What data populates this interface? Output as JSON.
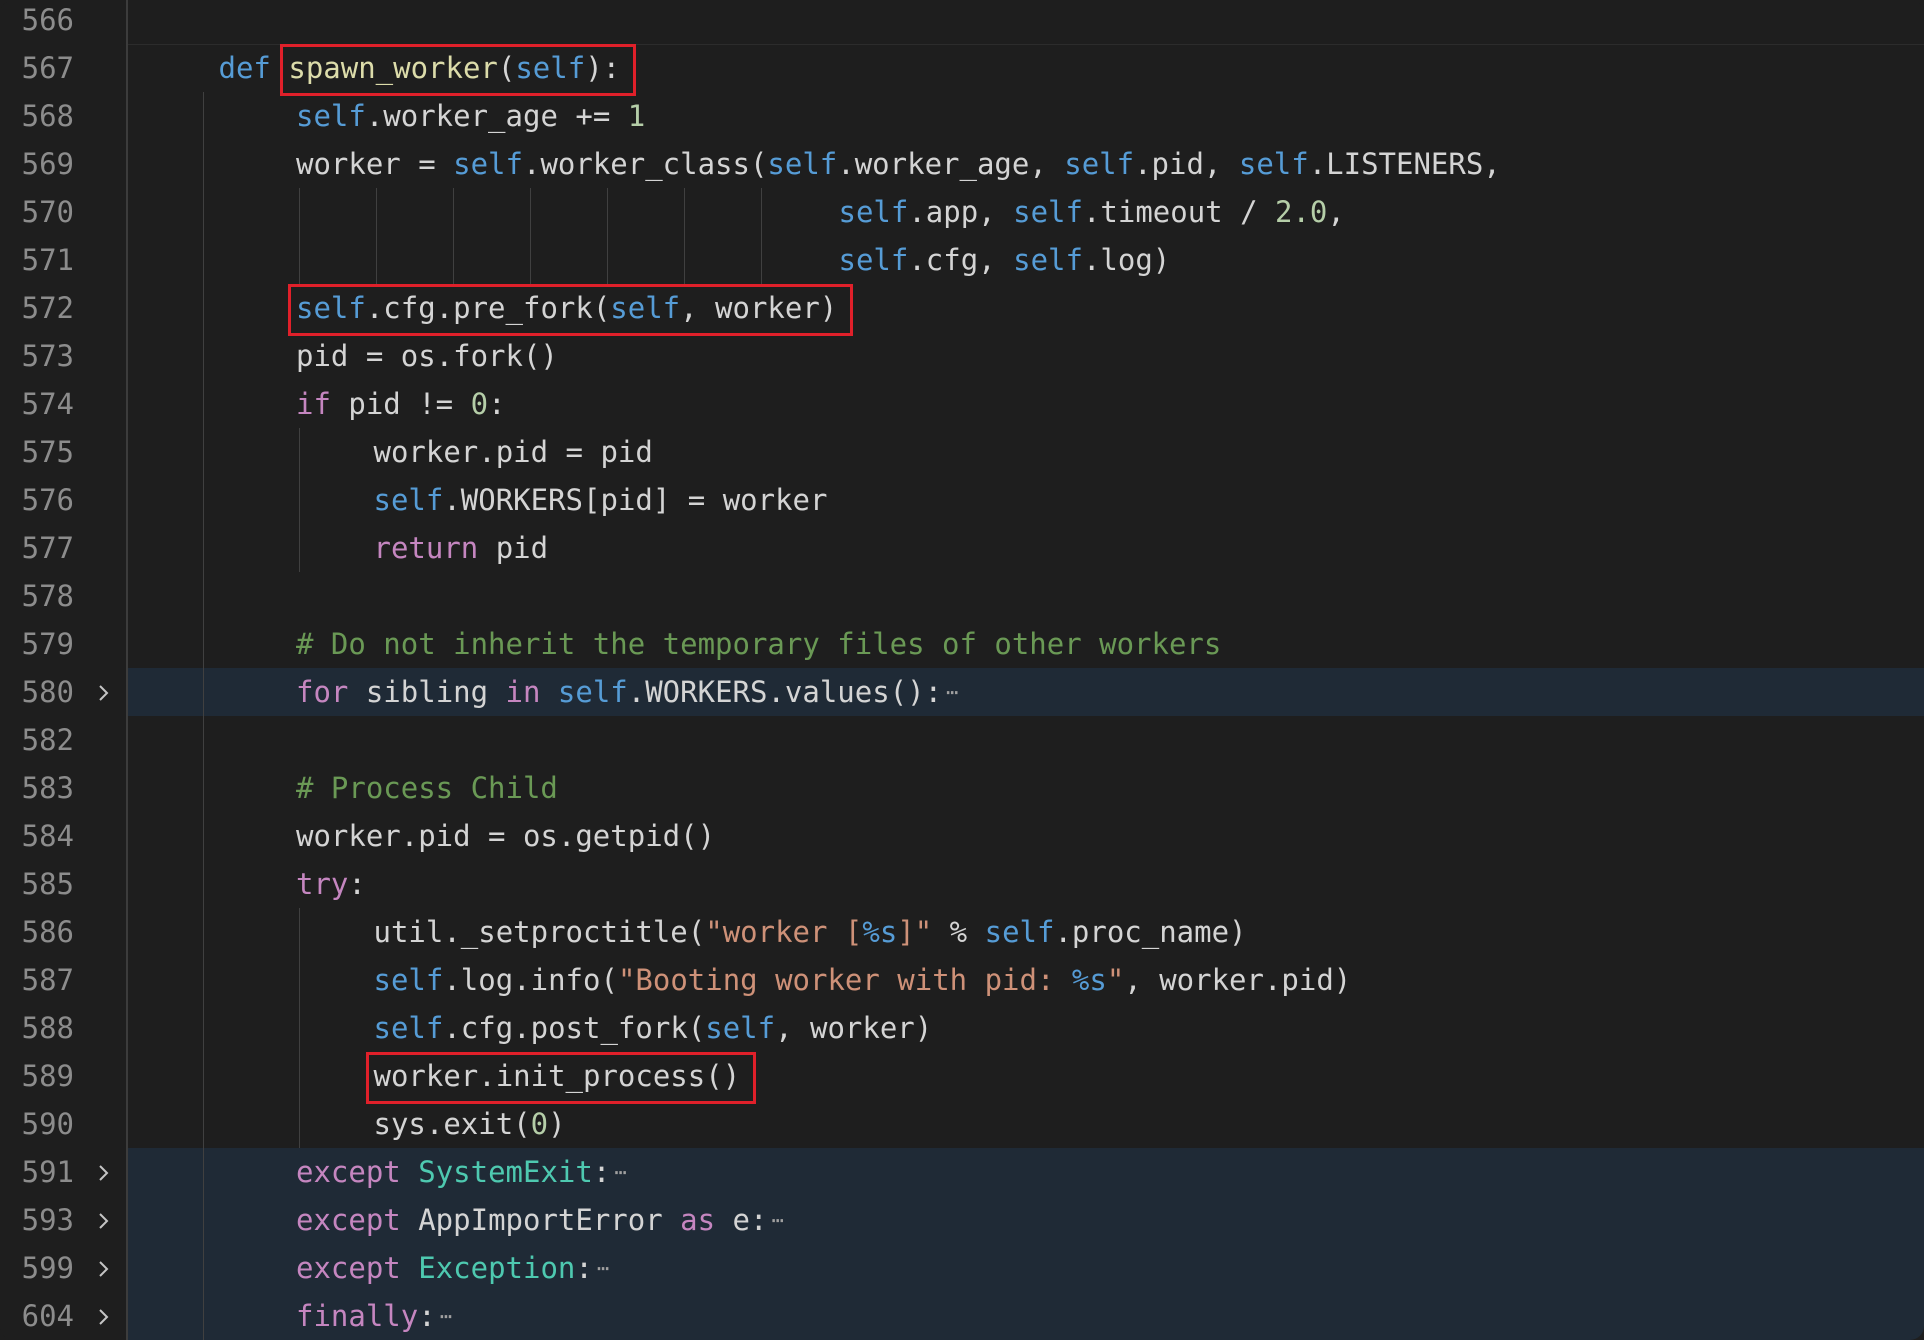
{
  "lines": [
    {
      "num": "566",
      "folded": false,
      "indent": 0,
      "tokens": []
    },
    {
      "num": "567",
      "folded": false,
      "indent": 1,
      "tokens": [
        {
          "t": "def",
          "c": "kw-def"
        },
        {
          "t": " "
        },
        {
          "t": "spawn_worker",
          "c": "fn"
        },
        {
          "t": "("
        },
        {
          "t": "self",
          "c": "self"
        },
        {
          "t": "):"
        }
      ]
    },
    {
      "num": "568",
      "folded": false,
      "indent": 2,
      "tokens": [
        {
          "t": "self",
          "c": "self"
        },
        {
          "t": ".worker_age += "
        },
        {
          "t": "1",
          "c": "num"
        }
      ]
    },
    {
      "num": "569",
      "folded": false,
      "indent": 2,
      "tokens": [
        {
          "t": "worker = "
        },
        {
          "t": "self",
          "c": "self"
        },
        {
          "t": ".worker_class("
        },
        {
          "t": "self",
          "c": "self"
        },
        {
          "t": ".worker_age, "
        },
        {
          "t": "self",
          "c": "self"
        },
        {
          "t": ".pid, "
        },
        {
          "t": "self",
          "c": "self"
        },
        {
          "t": ".LISTENERS,"
        }
      ]
    },
    {
      "num": "570",
      "folded": false,
      "indent": 9,
      "tokens": [
        {
          "t": "self",
          "c": "self"
        },
        {
          "t": ".app, "
        },
        {
          "t": "self",
          "c": "self"
        },
        {
          "t": ".timeout / "
        },
        {
          "t": "2.0",
          "c": "num"
        },
        {
          "t": ","
        }
      ]
    },
    {
      "num": "571",
      "folded": false,
      "indent": 9,
      "tokens": [
        {
          "t": "self",
          "c": "self"
        },
        {
          "t": ".cfg, "
        },
        {
          "t": "self",
          "c": "self"
        },
        {
          "t": ".log)"
        }
      ]
    },
    {
      "num": "572",
      "folded": false,
      "indent": 2,
      "tokens": [
        {
          "t": "self",
          "c": "self"
        },
        {
          "t": ".cfg.pre_fork("
        },
        {
          "t": "self",
          "c": "self"
        },
        {
          "t": ", worker)"
        }
      ]
    },
    {
      "num": "573",
      "folded": false,
      "indent": 2,
      "tokens": [
        {
          "t": "pid = os.fork()"
        }
      ]
    },
    {
      "num": "574",
      "folded": false,
      "indent": 2,
      "tokens": [
        {
          "t": "if",
          "c": "kw"
        },
        {
          "t": " pid != "
        },
        {
          "t": "0",
          "c": "num"
        },
        {
          "t": ":"
        }
      ]
    },
    {
      "num": "575",
      "folded": false,
      "indent": 3,
      "tokens": [
        {
          "t": "worker.pid = pid"
        }
      ]
    },
    {
      "num": "576",
      "folded": false,
      "indent": 3,
      "tokens": [
        {
          "t": "self",
          "c": "self"
        },
        {
          "t": ".WORKERS[pid] = worker"
        }
      ]
    },
    {
      "num": "577",
      "folded": false,
      "indent": 3,
      "tokens": [
        {
          "t": "return",
          "c": "kw"
        },
        {
          "t": " pid"
        }
      ]
    },
    {
      "num": "578",
      "folded": false,
      "indent": 0,
      "tokens": []
    },
    {
      "num": "579",
      "folded": false,
      "indent": 2,
      "tokens": [
        {
          "t": "# Do not inherit the temporary files of other workers",
          "c": "cmt"
        }
      ]
    },
    {
      "num": "580",
      "folded": true,
      "indent": 2,
      "tokens": [
        {
          "t": "for",
          "c": "kw"
        },
        {
          "t": " sibling "
        },
        {
          "t": "in",
          "c": "kw"
        },
        {
          "t": " "
        },
        {
          "t": "self",
          "c": "self"
        },
        {
          "t": ".WORKERS.values():"
        }
      ]
    },
    {
      "num": "582",
      "folded": false,
      "indent": 0,
      "tokens": []
    },
    {
      "num": "583",
      "folded": false,
      "indent": 2,
      "tokens": [
        {
          "t": "# Process Child",
          "c": "cmt"
        }
      ]
    },
    {
      "num": "584",
      "folded": false,
      "indent": 2,
      "tokens": [
        {
          "t": "worker.pid = os.getpid()"
        }
      ]
    },
    {
      "num": "585",
      "folded": false,
      "indent": 2,
      "tokens": [
        {
          "t": "try",
          "c": "kw"
        },
        {
          "t": ":"
        }
      ]
    },
    {
      "num": "586",
      "folded": false,
      "indent": 3,
      "tokens": [
        {
          "t": "util._setproctitle("
        },
        {
          "t": "\"worker [",
          "c": "str"
        },
        {
          "t": "%s",
          "c": "fmt"
        },
        {
          "t": "]\"",
          "c": "str"
        },
        {
          "t": " % "
        },
        {
          "t": "self",
          "c": "self"
        },
        {
          "t": ".proc_name)"
        }
      ]
    },
    {
      "num": "587",
      "folded": false,
      "indent": 3,
      "tokens": [
        {
          "t": "self",
          "c": "self"
        },
        {
          "t": ".log.info("
        },
        {
          "t": "\"Booting worker with pid: ",
          "c": "str"
        },
        {
          "t": "%s",
          "c": "fmt"
        },
        {
          "t": "\"",
          "c": "str"
        },
        {
          "t": ", worker.pid)"
        }
      ]
    },
    {
      "num": "588",
      "folded": false,
      "indent": 3,
      "tokens": [
        {
          "t": "self",
          "c": "self"
        },
        {
          "t": ".cfg.post_fork("
        },
        {
          "t": "self",
          "c": "self"
        },
        {
          "t": ", worker)"
        }
      ]
    },
    {
      "num": "589",
      "folded": false,
      "indent": 3,
      "tokens": [
        {
          "t": "worker.init_process()"
        }
      ]
    },
    {
      "num": "590",
      "folded": false,
      "indent": 3,
      "tokens": [
        {
          "t": "sys.exit("
        },
        {
          "t": "0",
          "c": "num"
        },
        {
          "t": ")"
        }
      ]
    },
    {
      "num": "591",
      "folded": true,
      "indent": 2,
      "tokens": [
        {
          "t": "except",
          "c": "kw"
        },
        {
          "t": " "
        },
        {
          "t": "SystemExit",
          "c": "cls"
        },
        {
          "t": ":"
        }
      ]
    },
    {
      "num": "593",
      "folded": true,
      "indent": 2,
      "tokens": [
        {
          "t": "except",
          "c": "kw"
        },
        {
          "t": " AppImportError "
        },
        {
          "t": "as",
          "c": "kw"
        },
        {
          "t": " e:"
        }
      ]
    },
    {
      "num": "599",
      "folded": true,
      "indent": 2,
      "tokens": [
        {
          "t": "except",
          "c": "kw"
        },
        {
          "t": " "
        },
        {
          "t": "Exception",
          "c": "cls"
        },
        {
          "t": ":"
        }
      ]
    },
    {
      "num": "604",
      "folded": true,
      "indent": 2,
      "tokens": [
        {
          "t": "finally",
          "c": "kw"
        },
        {
          "t": ":"
        }
      ]
    }
  ],
  "fold_icon": "chevron-right-icon",
  "ellipsis_icon": "folded-ellipsis-icon",
  "highlight_color": "#e0202a",
  "highlights": [
    {
      "name": "highlight-spawn-worker",
      "text": "spawn_worker(self):"
    },
    {
      "name": "highlight-pre-fork",
      "text": "self.cfg.pre_fork(self, worker)"
    },
    {
      "name": "highlight-init-process",
      "text": "worker.init_process()"
    }
  ]
}
